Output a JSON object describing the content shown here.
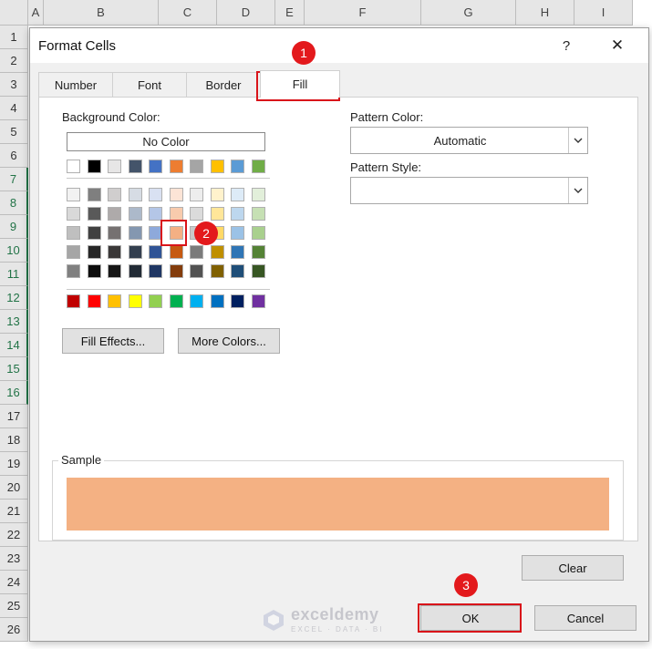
{
  "sheet": {
    "columns": [
      "A",
      "B",
      "C",
      "D",
      "E",
      "F",
      "G",
      "H",
      "I"
    ],
    "rows": [
      "1",
      "2",
      "3",
      "4",
      "5",
      "6",
      "7",
      "8",
      "9",
      "10",
      "11",
      "12",
      "13",
      "14",
      "15",
      "16",
      "17",
      "18",
      "19",
      "20",
      "21",
      "22",
      "23",
      "24",
      "25",
      "26"
    ]
  },
  "dialog": {
    "title": "Format Cells",
    "help": "?",
    "close": "✕",
    "tabs": [
      "Number",
      "Font",
      "Border",
      "Fill"
    ],
    "active_tab": "Fill",
    "background_color_label": "Background Color:",
    "no_color_label": "No Color",
    "pattern_color_label": "Pattern Color:",
    "pattern_color_value": "Automatic",
    "pattern_style_label": "Pattern Style:",
    "pattern_style_value": "",
    "fill_effects_label": "Fill Effects...",
    "more_colors_label": "More Colors...",
    "sample_label": "Sample",
    "sample_color": "#F4B183",
    "clear_label": "Clear",
    "ok_label": "OK",
    "cancel_label": "Cancel"
  },
  "palette": {
    "theme_row": [
      "#FFFFFF",
      "#000000",
      "#E7E6E6",
      "#44546A",
      "#4472C4",
      "#ED7D31",
      "#A5A5A5",
      "#FFC000",
      "#5B9BD5",
      "#70AD47"
    ],
    "tints": [
      [
        "#F2F2F2",
        "#7F7F7F",
        "#D0CECE",
        "#D6DCE4",
        "#D9E1F2",
        "#FCE4D6",
        "#EDEDED",
        "#FFF2CC",
        "#DDEBF7",
        "#E2EFDA"
      ],
      [
        "#D9D9D9",
        "#595959",
        "#AEAAAA",
        "#ACB9CA",
        "#B4C6E7",
        "#F8CBAD",
        "#DBDBDB",
        "#FFE699",
        "#BDD7EE",
        "#C6E0B4"
      ],
      [
        "#BFBFBF",
        "#404040",
        "#757171",
        "#8497B0",
        "#8EA9DB",
        "#F4B084",
        "#C9C9C9",
        "#FFD966",
        "#9BC2E6",
        "#A9D08E"
      ],
      [
        "#A6A6A6",
        "#262626",
        "#3A3838",
        "#333F4F",
        "#305496",
        "#C65911",
        "#7B7B7B",
        "#BF8F00",
        "#2F75B5",
        "#548235"
      ],
      [
        "#808080",
        "#0D0D0D",
        "#161616",
        "#222B35",
        "#203764",
        "#833C0C",
        "#525252",
        "#806000",
        "#1F4E78",
        "#375623"
      ]
    ],
    "standard": [
      "#C00000",
      "#FF0000",
      "#FFC000",
      "#FFFF00",
      "#92D050",
      "#00B050",
      "#00B0F0",
      "#0070C0",
      "#002060",
      "#7030A0"
    ],
    "selected": "#F4B084"
  },
  "annotations": {
    "step1": "1",
    "step2": "2",
    "step3": "3",
    "accent": "#E3191C"
  },
  "watermark": {
    "name": "exceldemy",
    "tagline": "EXCEL · DATA · BI"
  }
}
